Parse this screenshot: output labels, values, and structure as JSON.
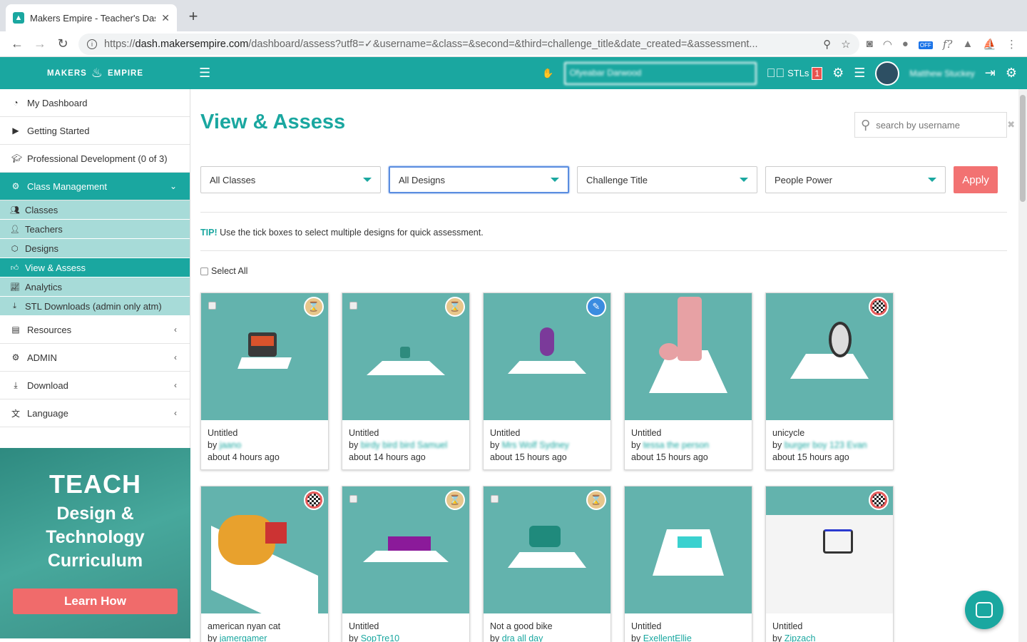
{
  "browser": {
    "tab_title": "Makers Empire - Teacher's Das",
    "url_prefix": "https://",
    "url_host": "dash.makersempire.com",
    "url_path": "/dashboard/assess?utf8=✓&username=&class=&second=&third=challenge_title&date_created=&assessment..."
  },
  "header": {
    "logo_left": "MAKERS",
    "logo_right": "EMPIRE",
    "school": "Ofyeabar Darwood",
    "stls_label": "STLs",
    "stls_count": "1",
    "username": "Matthew Stuckey"
  },
  "sidebar": {
    "top": [
      {
        "label": "My Dashboard",
        "icon": "dashboard-icon"
      },
      {
        "label": "Getting Started",
        "icon": "play-icon"
      },
      {
        "label": "Professional Development (0 of 3)",
        "icon": "graduation-cap-icon"
      }
    ],
    "class_management": "Class Management",
    "sub": [
      {
        "label": "Classes",
        "icon": "users-icon"
      },
      {
        "label": "Teachers",
        "icon": "user-icon"
      },
      {
        "label": "Designs",
        "icon": "cube-icon"
      },
      {
        "label": "View & Assess",
        "icon": "thumbs-up-icon"
      },
      {
        "label": "Analytics",
        "icon": "chart-icon"
      },
      {
        "label": "STL Downloads (admin only atm)",
        "icon": "download-icon"
      }
    ],
    "bottom": [
      {
        "label": "Resources",
        "icon": "book-icon"
      },
      {
        "label": "ADMIN",
        "icon": "gear-icon"
      },
      {
        "label": "Download",
        "icon": "download-icon"
      },
      {
        "label": "Language",
        "icon": "language-icon"
      }
    ]
  },
  "promo": {
    "heading": "TEACH",
    "subheading": "Design & Technology Curriculum",
    "button": "Learn How"
  },
  "page": {
    "title": "View & Assess",
    "search_placeholder": "search by username",
    "filters": [
      "All Classes",
      "All Designs",
      "Challenge Title",
      "People Power"
    ],
    "apply": "Apply",
    "tip_label": "TIP!",
    "tip_text": " Use the tick boxes to select multiple designs for quick assessment.",
    "select_all": "Select All"
  },
  "designs": [
    {
      "title": "Untitled",
      "by": "by",
      "author": "jaano",
      "time": "about 4 hours ago",
      "status": "pending",
      "checkbox": true
    },
    {
      "title": "Untitled",
      "by": "by",
      "author": "birdy bird bird Samuel",
      "time": "about 14 hours ago",
      "status": "pending",
      "checkbox": true
    },
    {
      "title": "Untitled",
      "by": "by",
      "author": "Mrs Wolf Sydney",
      "time": "about 15 hours ago",
      "status": "edit",
      "checkbox": false
    },
    {
      "title": "Untitled",
      "by": "by",
      "author": "tessa the person",
      "time": "about 15 hours ago",
      "status": "none",
      "checkbox": false
    },
    {
      "title": "unicycle",
      "by": "by",
      "author": "burger boy 123 Evan",
      "time": "about 15 hours ago",
      "status": "done",
      "checkbox": false
    },
    {
      "title": "american nyan cat",
      "by": "by",
      "author": "jamergamer",
      "time": "",
      "status": "done",
      "checkbox": false
    },
    {
      "title": "Untitled",
      "by": "by",
      "author": "SopTre10",
      "time": "",
      "status": "pending",
      "checkbox": true
    },
    {
      "title": "Not a good bike",
      "by": "by",
      "author": "dra all day",
      "time": "",
      "status": "pending",
      "checkbox": true
    },
    {
      "title": "Untitled",
      "by": "by",
      "author": "ExellentEllie",
      "time": "",
      "status": "none",
      "checkbox": false
    },
    {
      "title": "Untitled",
      "by": "by",
      "author": "Zipzach",
      "time": "",
      "status": "done",
      "checkbox": false
    }
  ],
  "colors": {
    "accent": "#1aa7a0",
    "apply": "#f27272",
    "thumb_bg": "#63b3ad"
  }
}
